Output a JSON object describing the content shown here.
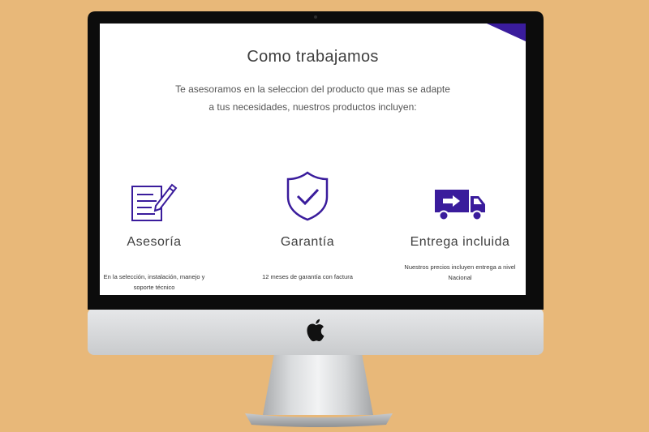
{
  "page": {
    "title": "Como trabajamos",
    "subtitle": "Te asesoramos en la seleccion del producto que mas se adapte a tus necesidades, nuestros productos incluyen:"
  },
  "features": [
    {
      "icon": "document-pen-icon",
      "title": "Asesoría",
      "description": "En la selección, instalación, manejo y soporte técnico"
    },
    {
      "icon": "shield-check-icon",
      "title": "Garantía",
      "description": "12 meses de garantía con factura"
    },
    {
      "icon": "delivery-truck-icon",
      "title": "Entrega incluida",
      "description": "Nuestros precios incluyen entrega a nivel Nacional"
    }
  ],
  "colors": {
    "background": "#e8b879",
    "accent": "#3a1c9c",
    "bezel": "#0c0c0c",
    "chin": "#d4d6d8"
  },
  "device": {
    "logo_icon": "apple-logo-icon"
  }
}
